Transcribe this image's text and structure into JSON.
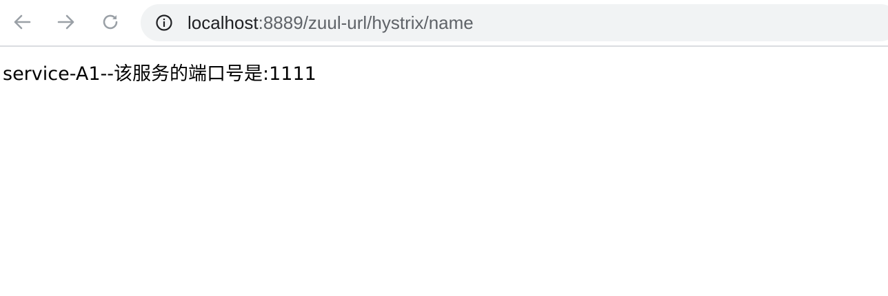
{
  "browser": {
    "nav": {
      "back_icon": "arrow-left-icon",
      "forward_icon": "arrow-right-icon",
      "reload_icon": "reload-icon"
    },
    "omnibox": {
      "info_icon": "info-circle-icon",
      "url_host": "localhost",
      "url_path": ":8889/zuul-url/hystrix/name"
    }
  },
  "page": {
    "body_text": "service-A1--该服务的端口号是:1111"
  },
  "colors": {
    "toolbar_bg": "#ffffff",
    "omnibox_bg": "#f1f3f4",
    "icon_gray": "#9aa0a6",
    "text": "#000000"
  }
}
